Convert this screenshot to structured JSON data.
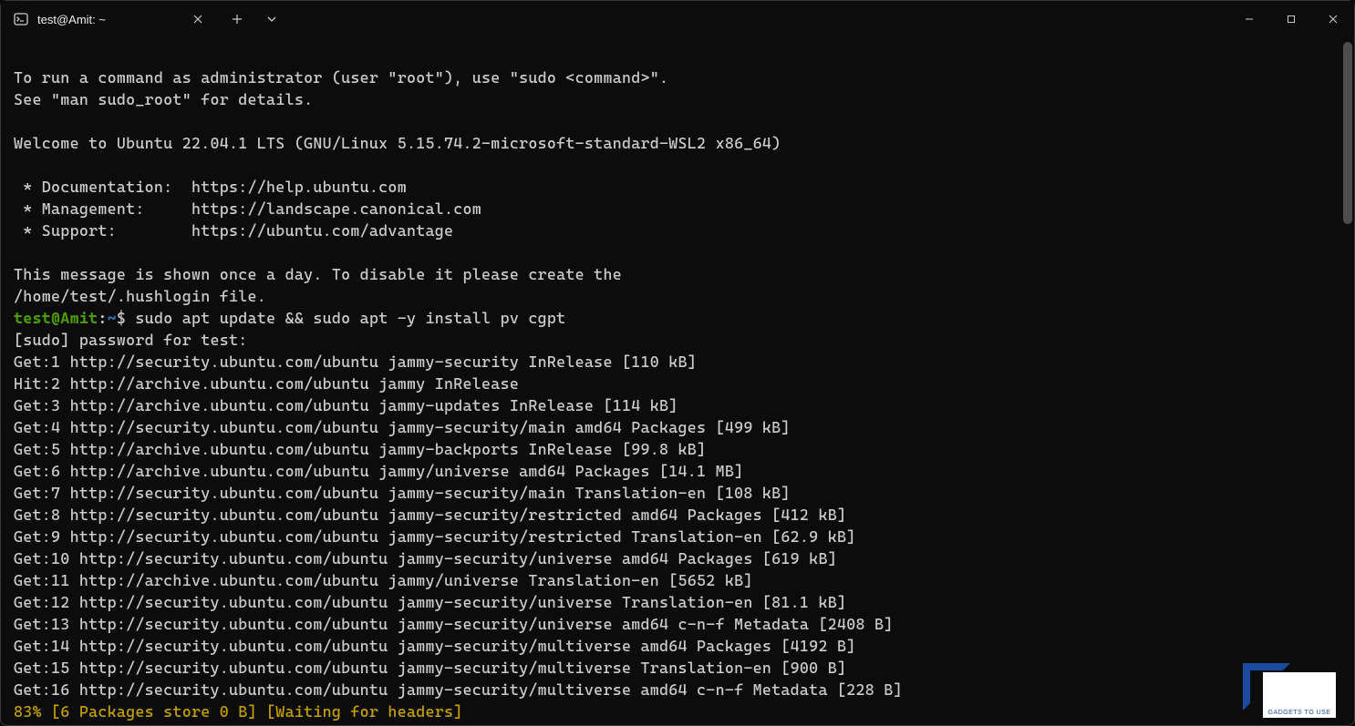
{
  "window": {
    "tab_title": "test@Amit: ~"
  },
  "motd": {
    "sudo_hint_1": "To run a command as administrator (user \"root\"), use \"sudo <command>\".",
    "sudo_hint_2": "See \"man sudo_root\" for details.",
    "welcome": "Welcome to Ubuntu 22.04.1 LTS (GNU/Linux 5.15.74.2-microsoft-standard-WSL2 x86_64)",
    "doc_label": " * Documentation:  https://help.ubuntu.com",
    "mgmt_label": " * Management:     https://landscape.canonical.com",
    "support_label": " * Support:        https://ubuntu.com/advantage",
    "once_a_day": "This message is shown once a day. To disable it please create the",
    "hushlogin": "/home/test/.hushlogin file."
  },
  "prompt": {
    "user_host": "test@Amit",
    "path": "~",
    "command": "sudo apt update && sudo apt -y install pv cgpt"
  },
  "apt": {
    "sudo_pw": "[sudo] password for test:",
    "lines": [
      "Get:1 http://security.ubuntu.com/ubuntu jammy-security InRelease [110 kB]",
      "Hit:2 http://archive.ubuntu.com/ubuntu jammy InRelease",
      "Get:3 http://archive.ubuntu.com/ubuntu jammy-updates InRelease [114 kB]",
      "Get:4 http://security.ubuntu.com/ubuntu jammy-security/main amd64 Packages [499 kB]",
      "Get:5 http://archive.ubuntu.com/ubuntu jammy-backports InRelease [99.8 kB]",
      "Get:6 http://archive.ubuntu.com/ubuntu jammy/universe amd64 Packages [14.1 MB]",
      "Get:7 http://security.ubuntu.com/ubuntu jammy-security/main Translation-en [108 kB]",
      "Get:8 http://security.ubuntu.com/ubuntu jammy-security/restricted amd64 Packages [412 kB]",
      "Get:9 http://security.ubuntu.com/ubuntu jammy-security/restricted Translation-en [62.9 kB]",
      "Get:10 http://security.ubuntu.com/ubuntu jammy-security/universe amd64 Packages [619 kB]",
      "Get:11 http://archive.ubuntu.com/ubuntu jammy/universe Translation-en [5652 kB]",
      "Get:12 http://security.ubuntu.com/ubuntu jammy-security/universe Translation-en [81.1 kB]",
      "Get:13 http://security.ubuntu.com/ubuntu jammy-security/universe amd64 c-n-f Metadata [2408 B]",
      "Get:14 http://security.ubuntu.com/ubuntu jammy-security/multiverse amd64 Packages [4192 B]",
      "Get:15 http://security.ubuntu.com/ubuntu jammy-security/multiverse Translation-en [900 B]",
      "Get:16 http://security.ubuntu.com/ubuntu jammy-security/multiverse amd64 c-n-f Metadata [228 B]"
    ],
    "progress": "83% [6 Packages store 0 B] [Waiting for headers]"
  },
  "watermark": "GADGETS TO USE"
}
